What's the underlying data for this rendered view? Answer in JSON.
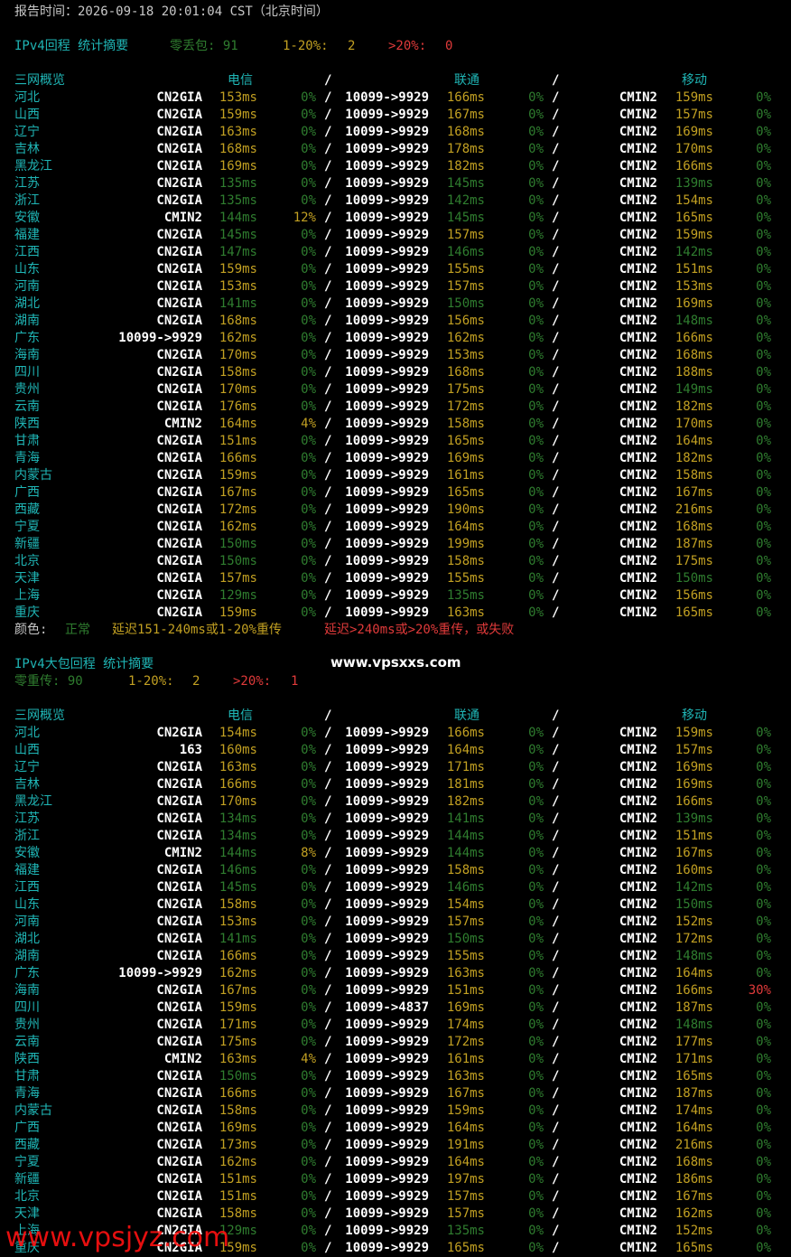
{
  "colors": {
    "good": "#2f7d2f",
    "warn": "#c2a022",
    "bad": "#e03a3a",
    "cyan": "#1fb5b5",
    "white": "#ffffff"
  },
  "report_time": "报告时间：2026-09-18 20:01:04 CST（北京时间）",
  "section1": {
    "title": "IPv4回程 统计摘要",
    "stats": [
      {
        "label": "零丢包: 91",
        "color": "good"
      },
      {
        "label": "1-20%:",
        "color": "warn"
      },
      {
        "label": "2",
        "color": "warn"
      },
      {
        "label": ">20%:",
        "color": "bad"
      },
      {
        "label": "0",
        "color": "bad"
      }
    ],
    "header": {
      "overview": "三网概览",
      "ct": "电信",
      "sep": "/",
      "cu": "联通",
      "cm": "移动"
    },
    "rows": [
      [
        "河北",
        "CN2GIA",
        "153ms",
        "0%",
        "10099->9929",
        "166ms",
        "0%",
        "CMIN2",
        "159ms",
        "0%"
      ],
      [
        "山西",
        "CN2GIA",
        "159ms",
        "0%",
        "10099->9929",
        "167ms",
        "0%",
        "CMIN2",
        "157ms",
        "0%"
      ],
      [
        "辽宁",
        "CN2GIA",
        "163ms",
        "0%",
        "10099->9929",
        "168ms",
        "0%",
        "CMIN2",
        "169ms",
        "0%"
      ],
      [
        "吉林",
        "CN2GIA",
        "168ms",
        "0%",
        "10099->9929",
        "178ms",
        "0%",
        "CMIN2",
        "170ms",
        "0%"
      ],
      [
        "黑龙江",
        "CN2GIA",
        "169ms",
        "0%",
        "10099->9929",
        "182ms",
        "0%",
        "CMIN2",
        "166ms",
        "0%"
      ],
      [
        "江苏",
        "CN2GIA",
        "135ms",
        "0%",
        "10099->9929",
        "145ms",
        "0%",
        "CMIN2",
        "139ms",
        "0%"
      ],
      [
        "浙江",
        "CN2GIA",
        "135ms",
        "0%",
        "10099->9929",
        "142ms",
        "0%",
        "CMIN2",
        "154ms",
        "0%"
      ],
      [
        "安徽",
        "CMIN2",
        "144ms",
        "12%",
        "10099->9929",
        "145ms",
        "0%",
        "CMIN2",
        "165ms",
        "0%"
      ],
      [
        "福建",
        "CN2GIA",
        "145ms",
        "0%",
        "10099->9929",
        "157ms",
        "0%",
        "CMIN2",
        "159ms",
        "0%"
      ],
      [
        "江西",
        "CN2GIA",
        "147ms",
        "0%",
        "10099->9929",
        "146ms",
        "0%",
        "CMIN2",
        "142ms",
        "0%"
      ],
      [
        "山东",
        "CN2GIA",
        "159ms",
        "0%",
        "10099->9929",
        "155ms",
        "0%",
        "CMIN2",
        "151ms",
        "0%"
      ],
      [
        "河南",
        "CN2GIA",
        "153ms",
        "0%",
        "10099->9929",
        "157ms",
        "0%",
        "CMIN2",
        "153ms",
        "0%"
      ],
      [
        "湖北",
        "CN2GIA",
        "141ms",
        "0%",
        "10099->9929",
        "150ms",
        "0%",
        "CMIN2",
        "169ms",
        "0%"
      ],
      [
        "湖南",
        "CN2GIA",
        "168ms",
        "0%",
        "10099->9929",
        "156ms",
        "0%",
        "CMIN2",
        "148ms",
        "0%"
      ],
      [
        "广东",
        "10099->9929",
        "162ms",
        "0%",
        "10099->9929",
        "162ms",
        "0%",
        "CMIN2",
        "166ms",
        "0%"
      ],
      [
        "海南",
        "CN2GIA",
        "170ms",
        "0%",
        "10099->9929",
        "153ms",
        "0%",
        "CMIN2",
        "168ms",
        "0%"
      ],
      [
        "四川",
        "CN2GIA",
        "158ms",
        "0%",
        "10099->9929",
        "168ms",
        "0%",
        "CMIN2",
        "188ms",
        "0%"
      ],
      [
        "贵州",
        "CN2GIA",
        "170ms",
        "0%",
        "10099->9929",
        "175ms",
        "0%",
        "CMIN2",
        "149ms",
        "0%"
      ],
      [
        "云南",
        "CN2GIA",
        "176ms",
        "0%",
        "10099->9929",
        "172ms",
        "0%",
        "CMIN2",
        "182ms",
        "0%"
      ],
      [
        "陕西",
        "CMIN2",
        "164ms",
        "4%",
        "10099->9929",
        "158ms",
        "0%",
        "CMIN2",
        "170ms",
        "0%"
      ],
      [
        "甘肃",
        "CN2GIA",
        "151ms",
        "0%",
        "10099->9929",
        "165ms",
        "0%",
        "CMIN2",
        "164ms",
        "0%"
      ],
      [
        "青海",
        "CN2GIA",
        "166ms",
        "0%",
        "10099->9929",
        "169ms",
        "0%",
        "CMIN2",
        "182ms",
        "0%"
      ],
      [
        "内蒙古",
        "CN2GIA",
        "159ms",
        "0%",
        "10099->9929",
        "161ms",
        "0%",
        "CMIN2",
        "158ms",
        "0%"
      ],
      [
        "广西",
        "CN2GIA",
        "167ms",
        "0%",
        "10099->9929",
        "165ms",
        "0%",
        "CMIN2",
        "167ms",
        "0%"
      ],
      [
        "西藏",
        "CN2GIA",
        "172ms",
        "0%",
        "10099->9929",
        "190ms",
        "0%",
        "CMIN2",
        "216ms",
        "0%"
      ],
      [
        "宁夏",
        "CN2GIA",
        "162ms",
        "0%",
        "10099->9929",
        "164ms",
        "0%",
        "CMIN2",
        "168ms",
        "0%"
      ],
      [
        "新疆",
        "CN2GIA",
        "150ms",
        "0%",
        "10099->9929",
        "199ms",
        "0%",
        "CMIN2",
        "187ms",
        "0%"
      ],
      [
        "北京",
        "CN2GIA",
        "150ms",
        "0%",
        "10099->9929",
        "158ms",
        "0%",
        "CMIN2",
        "175ms",
        "0%"
      ],
      [
        "天津",
        "CN2GIA",
        "157ms",
        "0%",
        "10099->9929",
        "155ms",
        "0%",
        "CMIN2",
        "150ms",
        "0%"
      ],
      [
        "上海",
        "CN2GIA",
        "129ms",
        "0%",
        "10099->9929",
        "135ms",
        "0%",
        "CMIN2",
        "156ms",
        "0%"
      ],
      [
        "重庆",
        "CN2GIA",
        "159ms",
        "0%",
        "10099->9929",
        "163ms",
        "0%",
        "CMIN2",
        "165ms",
        "0%"
      ]
    ],
    "legend": [
      {
        "label": "颜色:",
        "color": "white"
      },
      {
        "label": "正常",
        "color": "good"
      },
      {
        "label": "延迟151-240ms或1-20%重传",
        "color": "warn"
      },
      {
        "label": "延迟>240ms或>20%重传，或失败",
        "color": "bad"
      }
    ]
  },
  "watermark_top": "www.vpsxxs.com",
  "section2": {
    "title": "IPv4大包回程 统计摘要",
    "stats": [
      {
        "label": "零重传: 90",
        "color": "good"
      },
      {
        "label": "1-20%:",
        "color": "warn"
      },
      {
        "label": "2",
        "color": "warn"
      },
      {
        "label": ">20%:",
        "color": "bad"
      },
      {
        "label": "1",
        "color": "bad"
      }
    ],
    "header": {
      "overview": "三网概览",
      "ct": "电信",
      "sep": "/",
      "cu": "联通",
      "cm": "移动"
    },
    "rows": [
      [
        "河北",
        "CN2GIA",
        "154ms",
        "0%",
        "10099->9929",
        "166ms",
        "0%",
        "CMIN2",
        "159ms",
        "0%"
      ],
      [
        "山西",
        "163",
        "160ms",
        "0%",
        "10099->9929",
        "164ms",
        "0%",
        "CMIN2",
        "157ms",
        "0%"
      ],
      [
        "辽宁",
        "CN2GIA",
        "163ms",
        "0%",
        "10099->9929",
        "171ms",
        "0%",
        "CMIN2",
        "169ms",
        "0%"
      ],
      [
        "吉林",
        "CN2GIA",
        "166ms",
        "0%",
        "10099->9929",
        "181ms",
        "0%",
        "CMIN2",
        "169ms",
        "0%"
      ],
      [
        "黑龙江",
        "CN2GIA",
        "170ms",
        "0%",
        "10099->9929",
        "182ms",
        "0%",
        "CMIN2",
        "166ms",
        "0%"
      ],
      [
        "江苏",
        "CN2GIA",
        "134ms",
        "0%",
        "10099->9929",
        "141ms",
        "0%",
        "CMIN2",
        "139ms",
        "0%"
      ],
      [
        "浙江",
        "CN2GIA",
        "134ms",
        "0%",
        "10099->9929",
        "144ms",
        "0%",
        "CMIN2",
        "151ms",
        "0%"
      ],
      [
        "安徽",
        "CMIN2",
        "144ms",
        "8%",
        "10099->9929",
        "144ms",
        "0%",
        "CMIN2",
        "167ms",
        "0%"
      ],
      [
        "福建",
        "CN2GIA",
        "146ms",
        "0%",
        "10099->9929",
        "158ms",
        "0%",
        "CMIN2",
        "160ms",
        "0%"
      ],
      [
        "江西",
        "CN2GIA",
        "145ms",
        "0%",
        "10099->9929",
        "146ms",
        "0%",
        "CMIN2",
        "142ms",
        "0%"
      ],
      [
        "山东",
        "CN2GIA",
        "158ms",
        "0%",
        "10099->9929",
        "154ms",
        "0%",
        "CMIN2",
        "150ms",
        "0%"
      ],
      [
        "河南",
        "CN2GIA",
        "153ms",
        "0%",
        "10099->9929",
        "157ms",
        "0%",
        "CMIN2",
        "152ms",
        "0%"
      ],
      [
        "湖北",
        "CN2GIA",
        "141ms",
        "0%",
        "10099->9929",
        "150ms",
        "0%",
        "CMIN2",
        "172ms",
        "0%"
      ],
      [
        "湖南",
        "CN2GIA",
        "166ms",
        "0%",
        "10099->9929",
        "155ms",
        "0%",
        "CMIN2",
        "148ms",
        "0%"
      ],
      [
        "广东",
        "10099->9929",
        "162ms",
        "0%",
        "10099->9929",
        "163ms",
        "0%",
        "CMIN2",
        "164ms",
        "0%"
      ],
      [
        "海南",
        "CN2GIA",
        "167ms",
        "0%",
        "10099->9929",
        "151ms",
        "0%",
        "CMIN2",
        "166ms",
        "30%"
      ],
      [
        "四川",
        "CN2GIA",
        "159ms",
        "0%",
        "10099->4837",
        "169ms",
        "0%",
        "CMIN2",
        "187ms",
        "0%"
      ],
      [
        "贵州",
        "CN2GIA",
        "171ms",
        "0%",
        "10099->9929",
        "174ms",
        "0%",
        "CMIN2",
        "148ms",
        "0%"
      ],
      [
        "云南",
        "CN2GIA",
        "175ms",
        "0%",
        "10099->9929",
        "172ms",
        "0%",
        "CMIN2",
        "177ms",
        "0%"
      ],
      [
        "陕西",
        "CMIN2",
        "163ms",
        "4%",
        "10099->9929",
        "161ms",
        "0%",
        "CMIN2",
        "171ms",
        "0%"
      ],
      [
        "甘肃",
        "CN2GIA",
        "150ms",
        "0%",
        "10099->9929",
        "163ms",
        "0%",
        "CMIN2",
        "165ms",
        "0%"
      ],
      [
        "青海",
        "CN2GIA",
        "166ms",
        "0%",
        "10099->9929",
        "167ms",
        "0%",
        "CMIN2",
        "187ms",
        "0%"
      ],
      [
        "内蒙古",
        "CN2GIA",
        "158ms",
        "0%",
        "10099->9929",
        "159ms",
        "0%",
        "CMIN2",
        "174ms",
        "0%"
      ],
      [
        "广西",
        "CN2GIA",
        "169ms",
        "0%",
        "10099->9929",
        "164ms",
        "0%",
        "CMIN2",
        "164ms",
        "0%"
      ],
      [
        "西藏",
        "CN2GIA",
        "173ms",
        "0%",
        "10099->9929",
        "191ms",
        "0%",
        "CMIN2",
        "216ms",
        "0%"
      ],
      [
        "宁夏",
        "CN2GIA",
        "162ms",
        "0%",
        "10099->9929",
        "164ms",
        "0%",
        "CMIN2",
        "168ms",
        "0%"
      ],
      [
        "新疆",
        "CN2GIA",
        "151ms",
        "0%",
        "10099->9929",
        "197ms",
        "0%",
        "CMIN2",
        "186ms",
        "0%"
      ],
      [
        "北京",
        "CN2GIA",
        "151ms",
        "0%",
        "10099->9929",
        "157ms",
        "0%",
        "CMIN2",
        "167ms",
        "0%"
      ],
      [
        "天津",
        "CN2GIA",
        "158ms",
        "0%",
        "10099->9929",
        "157ms",
        "0%",
        "CMIN2",
        "162ms",
        "0%"
      ],
      [
        "上海",
        "CN2GIA",
        "129ms",
        "0%",
        "10099->9929",
        "135ms",
        "0%",
        "CMIN2",
        "152ms",
        "0%"
      ],
      [
        "重庆",
        "CN2GIA",
        "159ms",
        "0%",
        "10099->9929",
        "165ms",
        "0%",
        "CMIN2",
        "165ms",
        "0%"
      ]
    ]
  },
  "watermark_bottom": "www.vpsjyz.com"
}
